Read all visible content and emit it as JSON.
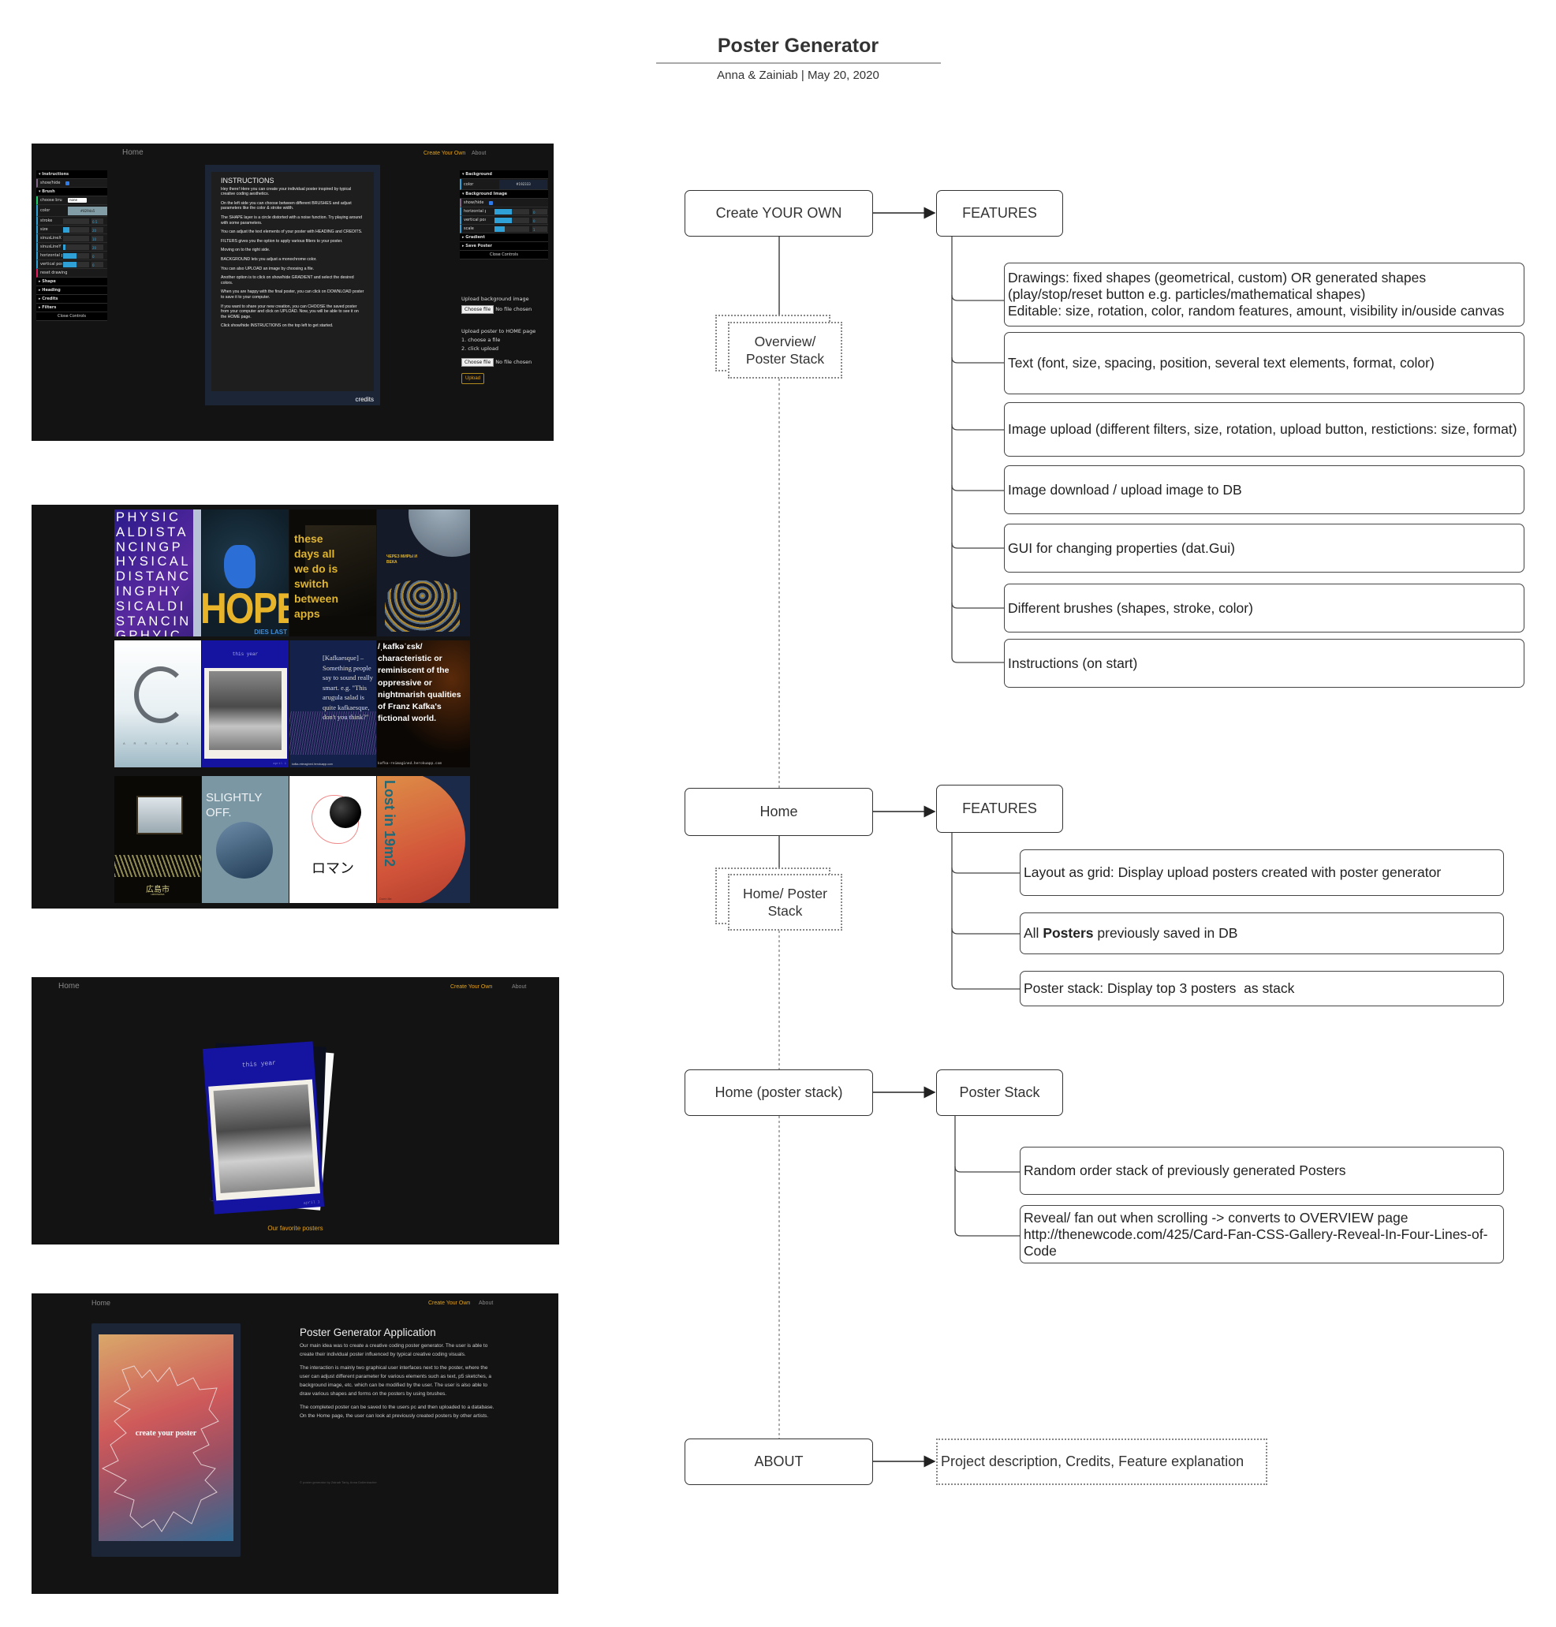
{
  "header": {
    "title": "Poster Generator",
    "subtitle": "Anna & Zainiab |  May 20, 2020"
  },
  "screenshots": {
    "create": {
      "nav": {
        "home": "Home",
        "create": "Create Your Own",
        "about": "About"
      },
      "left_gui": {
        "instructions_folder": "Instructions",
        "showhide_label": "show/hide",
        "brush_folder": "Brush",
        "choose_brush_label": "choose brush",
        "choose_brush_value": "none",
        "color_label": "color",
        "color_value": "#829da5",
        "sliders": [
          {
            "label": "stroke",
            "value": "0.5",
            "fill": 0.0
          },
          {
            "label": "size",
            "value": "20",
            "fill": 0.25
          },
          {
            "label": "sinusLineX",
            "value": "10",
            "fill": 0.0
          },
          {
            "label": "sinusLineY",
            "value": "20",
            "fill": 0.1
          },
          {
            "label": "horizontal pos",
            "value": "0",
            "fill": 0.5
          },
          {
            "label": "vertical pos",
            "value": "0",
            "fill": 0.5
          }
        ],
        "reset_label": "reset drawing",
        "folders": [
          "Shape",
          "Heading",
          "Credits",
          "Filters"
        ],
        "close_label": "Close Controls"
      },
      "instructions": {
        "title": "INSTRUCTIONS",
        "paragraphs": [
          "Hey there! Here you can create your individual poster inspired by typical creative coding aesthetics.",
          "On the left side you can choose between different BRUSHES and adjust parameters like the color & stroke width.",
          "The SHAPE layer is a circle distorted with a noise function. Try playing around with some parameters.",
          "You can adjust the text elements of your poster with HEADING and CREDITS.",
          "FILTERS gives you the option to apply various filters to your poster.",
          "Moving on to the right side.",
          "BACKGROUND lets you adjust a monochrome color.",
          "You can also UPLOAD an image by choosing a file.",
          "Another option is to click on show/hide GRADIENT and select the desired colors.",
          "When you are happy with the final poster, you can click on DOWNLOAD poster to save it to your computer.",
          "If you want to share your new creation, you can CHOOSE the saved poster from your computer and click on UPLOAD. Now, you will be able to see it on the HOME page.",
          "Click show/hide INSTRUCTIONS on the top left to get started."
        ],
        "credits": "credits"
      },
      "right_gui": {
        "background_folder": "Background",
        "color_label": "color",
        "color_value": "#192333",
        "bg_image_folder": "Background Image",
        "showhide_label": "show/hide",
        "sliders": [
          {
            "label": "horizontal pos",
            "value": "0",
            "fill": 0.5
          },
          {
            "label": "vertical pos",
            "value": "0",
            "fill": 0.5
          },
          {
            "label": "scale",
            "value": "1",
            "fill": 0.3
          }
        ],
        "folders": [
          "Gradient",
          "Save Poster"
        ],
        "close_label": "Close Controls"
      },
      "upload_bg": {
        "label": "Upload background image",
        "button": "Choose file",
        "status": "No file chosen"
      },
      "upload_home": {
        "label": "Upload poster to HOME page",
        "step1": "1. choose a file",
        "step2": "2. click upload",
        "button": "Choose file",
        "status": "No file chosen",
        "upload": "Upload"
      }
    },
    "grid": {
      "posters": [
        {
          "name": "physical-distancing",
          "text": "PHYSICALDISTANCINGPHYSICALDISTANCINGPHYSICALDISTANCINGPHYICAL"
        },
        {
          "name": "hope",
          "text": "HOPE",
          "sub": "DIES LAST"
        },
        {
          "name": "switch-apps",
          "text": "these days all we do is switch between apps"
        },
        {
          "name": "cherez-miry",
          "text": "ЧЕРЕЗ МИРЫ И ВЕКА"
        },
        {
          "name": "arrival",
          "text": "A R R I V A L"
        },
        {
          "name": "this-year",
          "text": "this year",
          "sub": "april 1"
        },
        {
          "name": "kafkaesque",
          "text": "[Kafkaesque] – Something people say to sound really smart. e.g. \"This arugula salad is quite kafkaesque, don't you think?\"",
          "sub": "kafka-reimagined.herokuapp.com"
        },
        {
          "name": "kafka-definition",
          "text": "/ˌkafkəˈɛsk/ characteristic or reminiscent of the oppressive or nightmarish qualities of Franz Kafka's fictional world.",
          "sub": "kafka-reimagined.herokuapp.com"
        },
        {
          "name": "hiroshima",
          "text": "広島市",
          "sub": "HIROSHIMA"
        },
        {
          "name": "slightly-off",
          "text": "SLIGHTLY OFF."
        },
        {
          "name": "roman",
          "text": "ロマン"
        },
        {
          "name": "lost-in-19m2",
          "text": "Lost in 19m2",
          "sub": "Donn ille"
        }
      ]
    },
    "stack": {
      "nav": {
        "home": "Home",
        "create": "Create Your Own",
        "about": "About"
      },
      "top_poster_title": "this year",
      "top_poster_sub": "april 1",
      "caption": "Our favorite posters"
    },
    "about": {
      "nav": {
        "home": "Home",
        "create": "Create Your Own",
        "about": "About"
      },
      "poster_text": "create your poster",
      "heading": "Poster Generator Application",
      "paragraphs": [
        "Our main idea was to create a creative coding poster generator. The user is able to create their individual poster influenced by typical creative coding visuals.",
        "The interaction is mainly two graphical user interfaces next to the poster, where the user can adjust different parameter for various elements such as text, p5 sketches, a background image, etc. which can be modified by the user. The user is also able to draw various shapes and forms on the posters by using brushes.",
        "The completed poster can be saved to the users pc and then uploaded to a database. On the Home page, the user can look at previously created posters by other artists."
      ],
      "footer": "© poster generator by Zainab Tariq, Anna Dollenbacher"
    }
  },
  "diagram": {
    "create_section": {
      "node": "Create YOUR OWN",
      "features_label": "FEATURES",
      "page_label": "Overview/ Poster Stack",
      "features": [
        "Drawings: fixed shapes (geometrical, custom) OR generated shapes|(play/stop/reset button e.g. particles/mathematical shapes)|Editable: size, rotation, color, random features, amount, visibility in/ouside canvas",
        "Text (font, size, spacing, position, several text elements, format, color)",
        "Image upload (different filters, size, rotation, upload button, restictions: size, format)",
        "Image download / upload image to DB",
        "GUI for changing properties (dat.Gui)",
        "Different brushes (shapes, stroke, color)",
        "Instructions (on start)"
      ]
    },
    "home_section": {
      "node": "Home",
      "features_label": "FEATURES",
      "page_label": "Home/ Poster Stack",
      "features": [
        {
          "pre": "Layout as grid: Display upload posters created with poster generator",
          "bold": "",
          "post": ""
        },
        {
          "pre": "All ",
          "bold": "Posters",
          "post": " previously saved in DB"
        },
        {
          "pre": "Poster stack: Display top 3 posters  as stack",
          "bold": "",
          "post": ""
        }
      ]
    },
    "stack_section": {
      "node": "Home (poster stack)",
      "target": "Poster Stack",
      "features": [
        "Random order stack of previously generated Posters",
        "Reveal/ fan out when scrolling -> converts to OVERVIEW page|http://thenewcode.com/425/Card-Fan-CSS-Gallery-Reveal-In-Four-Lines-of-Code"
      ]
    },
    "about_section": {
      "node": "ABOUT",
      "target": "Project description, Credits, Feature explanation"
    }
  },
  "colors": {
    "accent": "#e3a21a",
    "screen_bg": "#131313",
    "gui_slider": "#2fa1d6"
  }
}
